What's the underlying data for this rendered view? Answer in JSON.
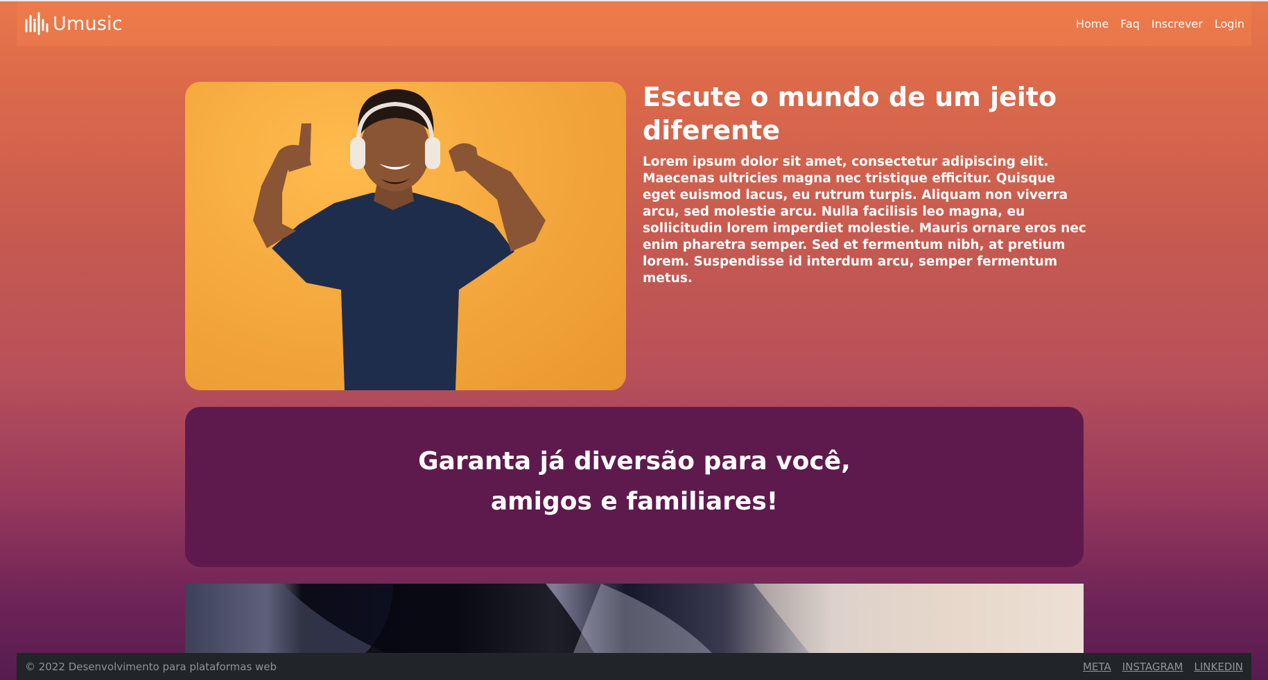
{
  "nav": {
    "brand": "Umusic",
    "links": [
      "Home",
      "Faq",
      "Inscrever",
      "Login"
    ]
  },
  "hero": {
    "title": "Escute o mundo de um jeito diferente",
    "body": "Lorem ipsum dolor sit amet, consectetur adipiscing elit. Maecenas ultricies magna nec tristique efficitur. Quisque eget euismod lacus, eu rutrum turpis. Aliquam non viverra arcu, sed molestie arcu. Nulla facilisis leo magna, eu sollicitudin lorem imperdiet molestie. Mauris ornare eros nec enim pharetra semper. Sed et fermentum nibh, at pretium lorem. Suspendisse id interdum arcu, semper fermentum metus."
  },
  "cta": {
    "line1": "Garanta já diversão para você,",
    "line2": "amigos e familiares!"
  },
  "footer": {
    "copyright": "© 2022 Desenvolvimento para plataformas web",
    "links": [
      "META",
      "INSTAGRAM",
      "LINKEDIN"
    ]
  },
  "colors": {
    "cta_background": "#5e1a4c",
    "footer_background": "#212529",
    "gradient_top": "#e8774a",
    "gradient_bottom": "#561c50"
  },
  "icons": {
    "brand": "music-equalizer-icon"
  }
}
